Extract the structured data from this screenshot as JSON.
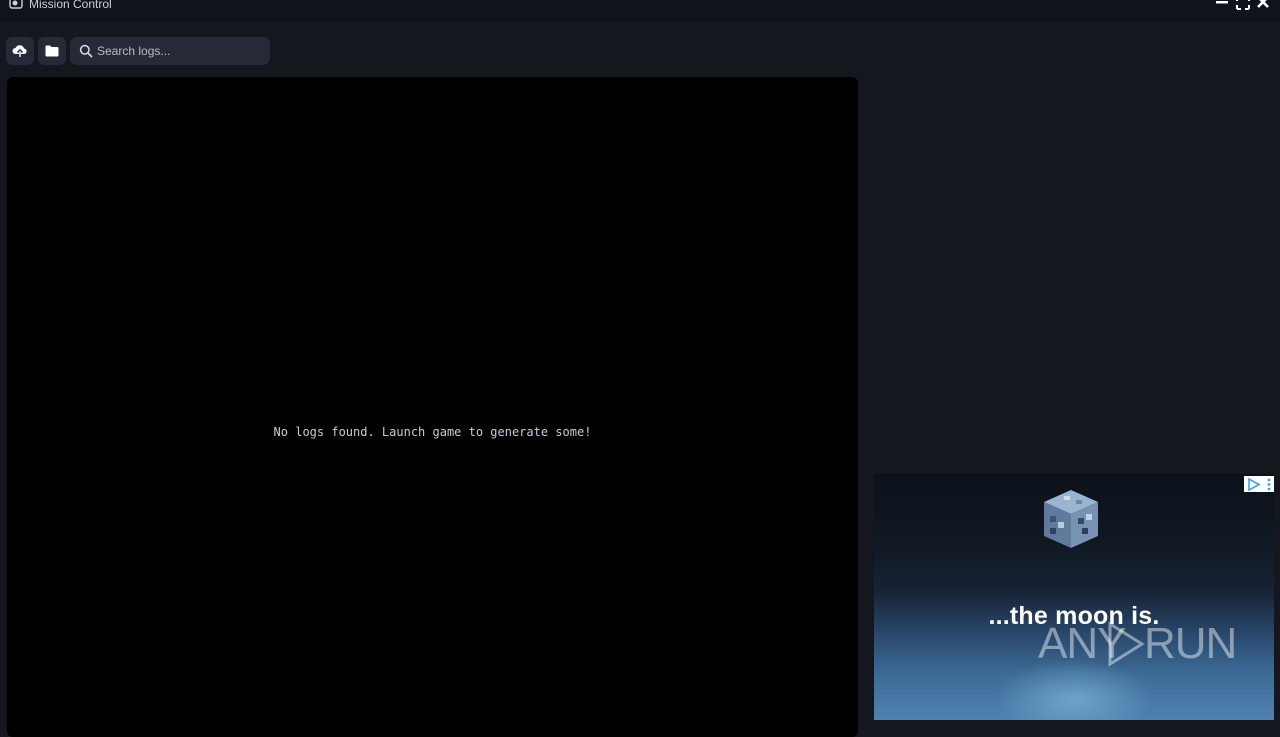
{
  "window": {
    "title": "Mission Control",
    "controls": {
      "minimize": "minimize-icon",
      "maximize": "maximize-icon",
      "close": "close-icon"
    }
  },
  "toolbar": {
    "upload_icon": "cloud-upload-icon",
    "folder_icon": "folder-icon",
    "search": {
      "placeholder": "Search logs...",
      "value": "",
      "icon": "search-icon"
    }
  },
  "logs": {
    "empty_message": "No logs found. Launch game to generate some!"
  },
  "ad": {
    "tagline": "...the moon is.",
    "badge_icon": "adchoices-icon"
  },
  "watermark": {
    "left": "ANY",
    "right": "RUN"
  },
  "colors": {
    "background": "#15171f",
    "titlebar": "#10131b",
    "control_bg": "#252a36",
    "log_panel": "#000000",
    "text": "#c8cbd6"
  }
}
